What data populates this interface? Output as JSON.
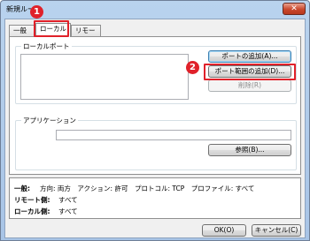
{
  "window": {
    "title": "新規ルール",
    "close_glyph": "✕"
  },
  "tabs": [
    {
      "label": "一般",
      "active": false
    },
    {
      "label": "ローカル",
      "active": true
    },
    {
      "label": "リモート",
      "active": false
    }
  ],
  "annotations": {
    "badge1": "1",
    "badge2": "2",
    "highlight_color": "#e0212a"
  },
  "local_port": {
    "group_label": "ローカルポート",
    "add_port_button": "ポートの追加(A)...",
    "add_port_range_button": "ポート範囲の追加(D)...",
    "delete_button": "削除(R)"
  },
  "application": {
    "group_label": "アプリケーション",
    "path_value": "",
    "browse_button": "参照(B)..."
  },
  "summary": {
    "general_label": "一般:",
    "general_value": "方向: 両方　アクション: 許可　プロトコル: TCP　プロファイル: すべて",
    "remote_label": "リモート側:",
    "remote_value": "すべて",
    "local_label": "ローカル側:",
    "local_value": "すべて"
  },
  "footer": {
    "ok_button": "OK(O)",
    "cancel_button": "キャンセル(C)"
  }
}
